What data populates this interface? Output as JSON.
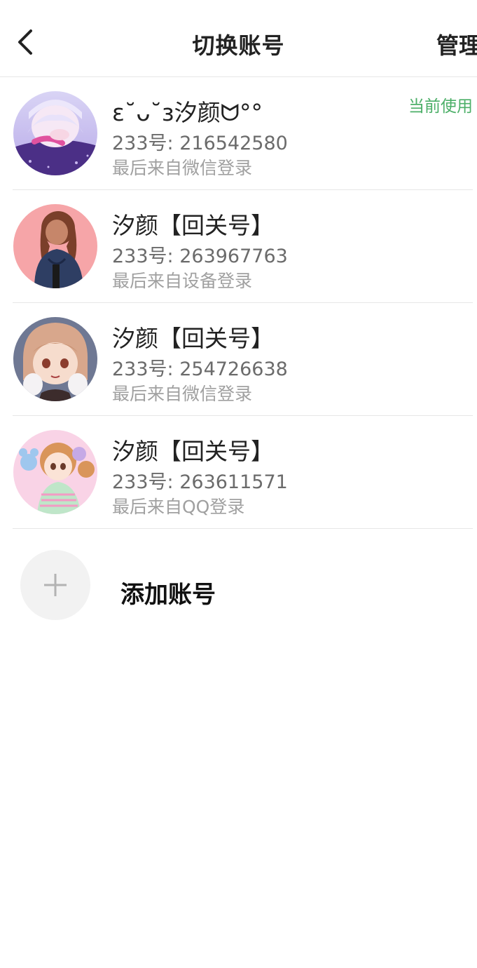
{
  "header": {
    "title": "切换账号",
    "manage_label": "管理"
  },
  "accounts": [
    {
      "name": "ɛ˘ᴗ˘ɜ汐颜ᗢ°°",
      "id_text": "233号: 216542580",
      "login_text": "最后来自微信登录",
      "current_label": "当前使用",
      "is_current": true
    },
    {
      "name": "汐颜【回关号】",
      "id_text": "233号: 263967763",
      "login_text": "最后来自设备登录",
      "is_current": false
    },
    {
      "name": "汐颜【回关号】",
      "id_text": "233号: 254726638",
      "login_text": "最后来自微信登录",
      "is_current": false
    },
    {
      "name": "汐颜【回关号】",
      "id_text": "233号: 263611571",
      "login_text": "最后来自QQ登录",
      "is_current": false
    }
  ],
  "add_account": {
    "label": "添加账号"
  },
  "colors": {
    "current_badge": "#4caf68",
    "divider": "#e6e6e6",
    "add_circle_bg": "#f2f2f2"
  },
  "icons": {
    "back": "chevron-left-icon",
    "add": "plus-icon"
  }
}
